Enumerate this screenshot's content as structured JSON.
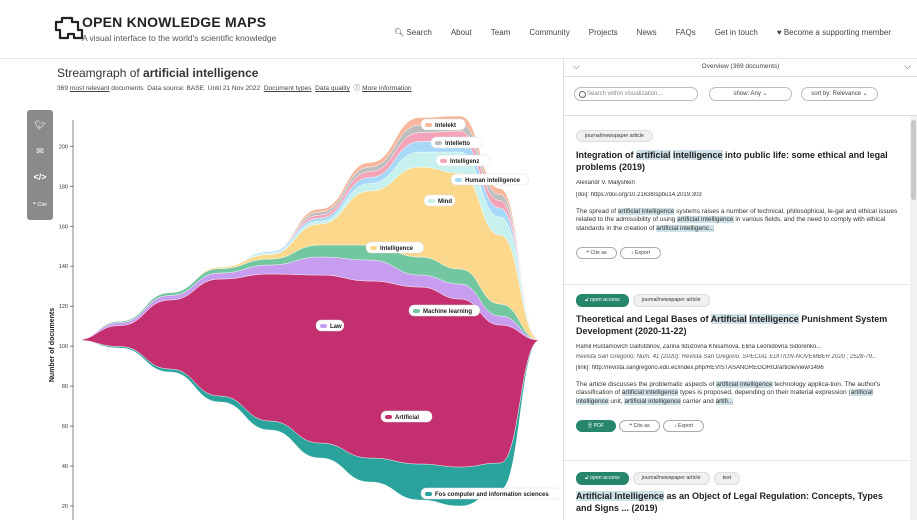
{
  "header": {
    "brand": "OPEN KNOWLEDGE MAPS",
    "tagline": "A visual interface to the world's scientific knowledge",
    "nav": [
      "Search",
      "About",
      "Team",
      "Community",
      "Projects",
      "News",
      "FAQs",
      "Get in touch",
      "Become a supporting member"
    ]
  },
  "viz": {
    "title_prefix": "Streamgraph of ",
    "title_query": "artificial intelligence",
    "meta_count": "369",
    "meta_relevant": "most relevant",
    "meta_documents": "documents",
    "meta_source": "Data source: BASE",
    "meta_until": "Until 21 Nov 2022",
    "meta_doc_types": "Document types",
    "meta_quality": "Data quality",
    "meta_more": "More information",
    "share": [
      "twitter-icon",
      "email-icon",
      "embed-icon"
    ],
    "cite_label": "Cite"
  },
  "chart_data": {
    "type": "area",
    "ylabel": "Number of documents",
    "y_ticks": [
      20,
      40,
      60,
      80,
      100,
      120,
      140,
      160,
      180,
      200
    ],
    "series": [
      {
        "name": "Fos computer and information sciences",
        "color": "#2aa39d"
      },
      {
        "name": "Artificial",
        "color": "#c4306f"
      },
      {
        "name": "Law",
        "color": "#c79df0"
      },
      {
        "name": "Machine learning",
        "color": "#73c7a0"
      },
      {
        "name": "Intelligence",
        "color": "#fbd88c"
      },
      {
        "name": "Mind",
        "color": "#c6f1ee"
      },
      {
        "name": "Human intelligence",
        "color": "#a8d8f7"
      },
      {
        "name": "Intelligenz",
        "color": "#f5a3b8"
      },
      {
        "name": "Intelletto",
        "color": "#bdbdbd"
      },
      {
        "name": "Intelekt",
        "color": "#f6b79c"
      }
    ]
  },
  "overview": {
    "title": "Overview (369 documents)",
    "search_placeholder": "Search within visualization...",
    "show": "show: Any",
    "sort": "sort by: Relevance"
  },
  "results": [
    {
      "tags": [
        "journal/newspaper article"
      ],
      "title_parts": [
        {
          "t": "Integration of ",
          "h": false
        },
        {
          "t": "artificial",
          "h": true
        },
        {
          "t": " ",
          "h": false
        },
        {
          "t": "intelligence",
          "h": true
        },
        {
          "t": " into public life: some ethical and legal problems (2019)",
          "h": false
        }
      ],
      "authors": "Alexandr V. Malyshkin",
      "link": "[doi]: https://doi.org/10.21638/spbu14.2019.303",
      "abstract_parts": [
        {
          "t": "The spread of ",
          "h": false
        },
        {
          "t": "artificial intelligence",
          "h": true
        },
        {
          "t": " systems raises a number of technical, philosophical, le-gal and ethical issues related to the admissibility of using ",
          "h": false
        },
        {
          "t": "artificial intelligence",
          "h": true
        },
        {
          "t": " in various fields, and the need to comply with ethical standards in the creation of ",
          "h": false
        },
        {
          "t": "artificial intelligenc...",
          "h": true
        }
      ],
      "buttons": [
        "Cite as",
        "Export"
      ]
    },
    {
      "tags": [
        "open access",
        "journal/newspaper article"
      ],
      "title_parts": [
        {
          "t": "Theoretical and Legal Bases of ",
          "h": false
        },
        {
          "t": "Artificial",
          "h": true
        },
        {
          "t": " ",
          "h": false
        },
        {
          "t": "Intelligence",
          "h": true
        },
        {
          "t": " Punishment System Development (2020-11-22)",
          "h": false
        }
      ],
      "authors": "Ramil Rustamovich Gaifutdinov, Zarina Ilduzovna Khisamova, Elina Leonidovna Sidorenko...",
      "source": "Revista San Gregorio; Núm. 41 (2020): Revista San Gregorio. SPECIAL EDITION-NOVEMBER 2020 ; 2528-79...",
      "link": "[link]: http://revista.sangregorio.edu.ec/index.php/REVISTASANGREGORIO/article/view/1496",
      "abstract_parts": [
        {
          "t": "The article discusses the problematic aspects of ",
          "h": false
        },
        {
          "t": "artificial intelligence",
          "h": true
        },
        {
          "t": " technology applica-tion. The author's classification of ",
          "h": false
        },
        {
          "t": "artificial intelligence",
          "h": true
        },
        {
          "t": " types is proposed, depending on their material expression (",
          "h": false
        },
        {
          "t": "artificial intelligence",
          "h": true
        },
        {
          "t": " unit, ",
          "h": false
        },
        {
          "t": "artificial intelligence",
          "h": true
        },
        {
          "t": " carrier and ",
          "h": false
        },
        {
          "t": "artifi...",
          "h": true
        }
      ],
      "buttons": [
        "PDF",
        "Cite as",
        "Export"
      ]
    },
    {
      "tags": [
        "open access",
        "journal/newspaper article",
        "text"
      ],
      "title_parts": [
        {
          "t": "Artificial Intelligence",
          "h": true
        },
        {
          "t": " as an Object of Legal Regulation: Concepts, Types and Signs ... (2019)",
          "h": false
        }
      ]
    }
  ]
}
